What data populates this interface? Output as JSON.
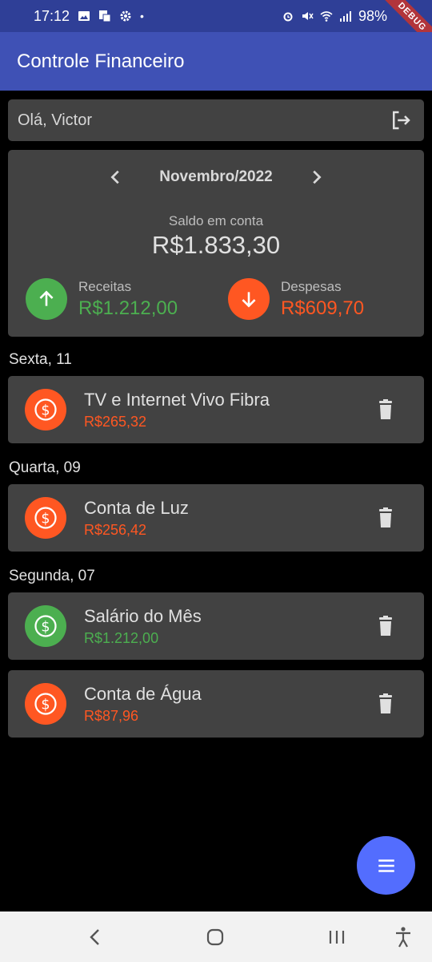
{
  "status_bar": {
    "time": "17:12",
    "battery": "98%",
    "debug_label": "DEBUG"
  },
  "app_bar": {
    "title": "Controle Financeiro"
  },
  "greeting": {
    "text": "Olá, Victor",
    "logout_icon": "logout-icon"
  },
  "summary": {
    "month": "Novembro/2022",
    "balance_label": "Saldo em conta",
    "balance_value": "R$1.833,30",
    "income": {
      "label": "Receitas",
      "value": "R$1.212,00",
      "icon": "arrow-up-icon"
    },
    "expense": {
      "label": "Despesas",
      "value": "R$609,70",
      "icon": "arrow-down-icon"
    }
  },
  "colors": {
    "income": "#4caf50",
    "expense": "#ff5722",
    "app_bar": "#3f51b5",
    "fab": "#536dfe",
    "card": "#424242"
  },
  "days": [
    {
      "header": "Sexta, 11",
      "transactions": [
        {
          "title": "TV e Internet Vivo Fibra",
          "amount": "R$265,32",
          "type": "expense"
        }
      ]
    },
    {
      "header": "Quarta, 09",
      "transactions": [
        {
          "title": "Conta de Luz",
          "amount": "R$256,42",
          "type": "expense"
        }
      ]
    },
    {
      "header": "Segunda, 07",
      "transactions": [
        {
          "title": "Salário do Mês",
          "amount": "R$1.212,00",
          "type": "income"
        },
        {
          "title": "Conta de Água",
          "amount": "R$87,96",
          "type": "expense"
        }
      ]
    }
  ],
  "fab": {
    "icon": "menu-icon"
  },
  "nav_bar": {
    "icons": [
      "back-icon",
      "home-icon",
      "recents-icon",
      "accessibility-icon"
    ]
  }
}
